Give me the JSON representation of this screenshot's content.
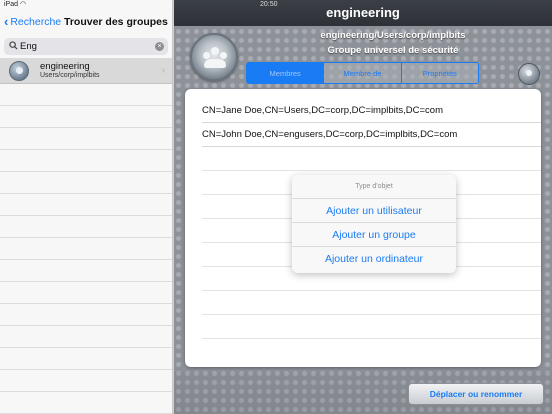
{
  "status_bar": {
    "carrier": "iPad",
    "time": "20:50"
  },
  "left": {
    "back_label": "Recherche",
    "title": "Trouver des groupes",
    "search": {
      "value": "Eng",
      "placeholder": ""
    },
    "results": [
      {
        "name": "engineering",
        "path": "Users/corp/implbits"
      }
    ]
  },
  "right": {
    "title": "engineering",
    "group_path": "engineering/Users/corp/implbits",
    "group_type": "Groupe universel de sécurité",
    "tabs": [
      {
        "label": "Membres",
        "active": true
      },
      {
        "label": "Membre de",
        "active": false
      },
      {
        "label": "Propriétés",
        "active": false
      }
    ],
    "members": [
      "CN=Jane Doe,CN=Users,DC=corp,DC=implbits,DC=com",
      "CN=John Doe,CN=engusers,DC=corp,DC=implbits,DC=com"
    ],
    "action_sheet": {
      "title": "Type d'objet",
      "items": [
        "Ajouter un utilisateur",
        "Ajouter un groupe",
        "Ajouter un ordinateur"
      ]
    },
    "move_button": "Déplacer ou renommer"
  },
  "colors": {
    "accent": "#1a7cf5",
    "topbar": "#33373d",
    "selected_row": "#d9d9d9"
  }
}
